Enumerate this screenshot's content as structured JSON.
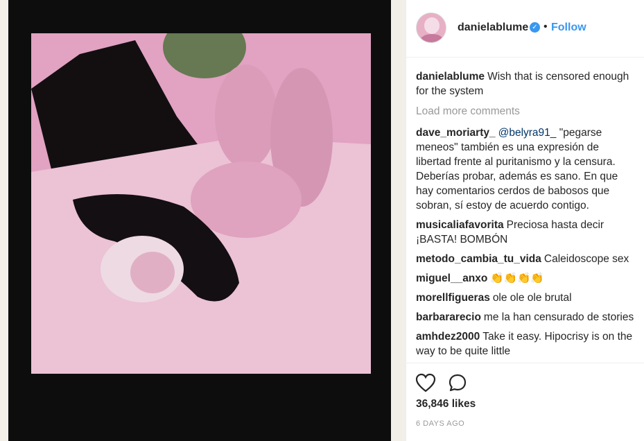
{
  "post": {
    "username": "danielablume",
    "follow_label": "Follow",
    "dot": "•",
    "verified_icon": "verified-badge-icon",
    "caption": "Wish that is censored enough for the system",
    "load_more": "Load more comments",
    "likes": "36,846 likes",
    "time": "6 DAYS AGO"
  },
  "comments": [
    {
      "user": "dave_moriarty_",
      "mention": "@belyra91_",
      "text": " \"pegarse meneos\" también es una expresión de libertad frente al puritanismo y la censura. Deberías probar, además es sano. En que hay comentarios cerdos de babosos que sobran, sí estoy de acuerdo contigo."
    },
    {
      "user": "musicaliafavorita",
      "mention": "",
      "text": "Preciosa hasta decir ¡BASTA! BOMBÓN"
    },
    {
      "user": "metodo_cambia_tu_vida",
      "mention": "",
      "text": "Caleidoscope sex"
    },
    {
      "user": "miguel__anxo",
      "mention": "",
      "text": "👏👏👏👏"
    },
    {
      "user": "morellfigueras",
      "mention": "",
      "text": "ole ole ole brutal"
    },
    {
      "user": "barbararecio",
      "mention": "",
      "text": "me la han censurado de stories"
    },
    {
      "user": "amhdez2000",
      "mention": "",
      "text": "Take it easy. Hipocrisy is on the way to be quite little"
    }
  ],
  "colors": {
    "accent": "#3897f0",
    "photo_tint": "#e9a7c8",
    "frame": "#0d0d0d"
  }
}
